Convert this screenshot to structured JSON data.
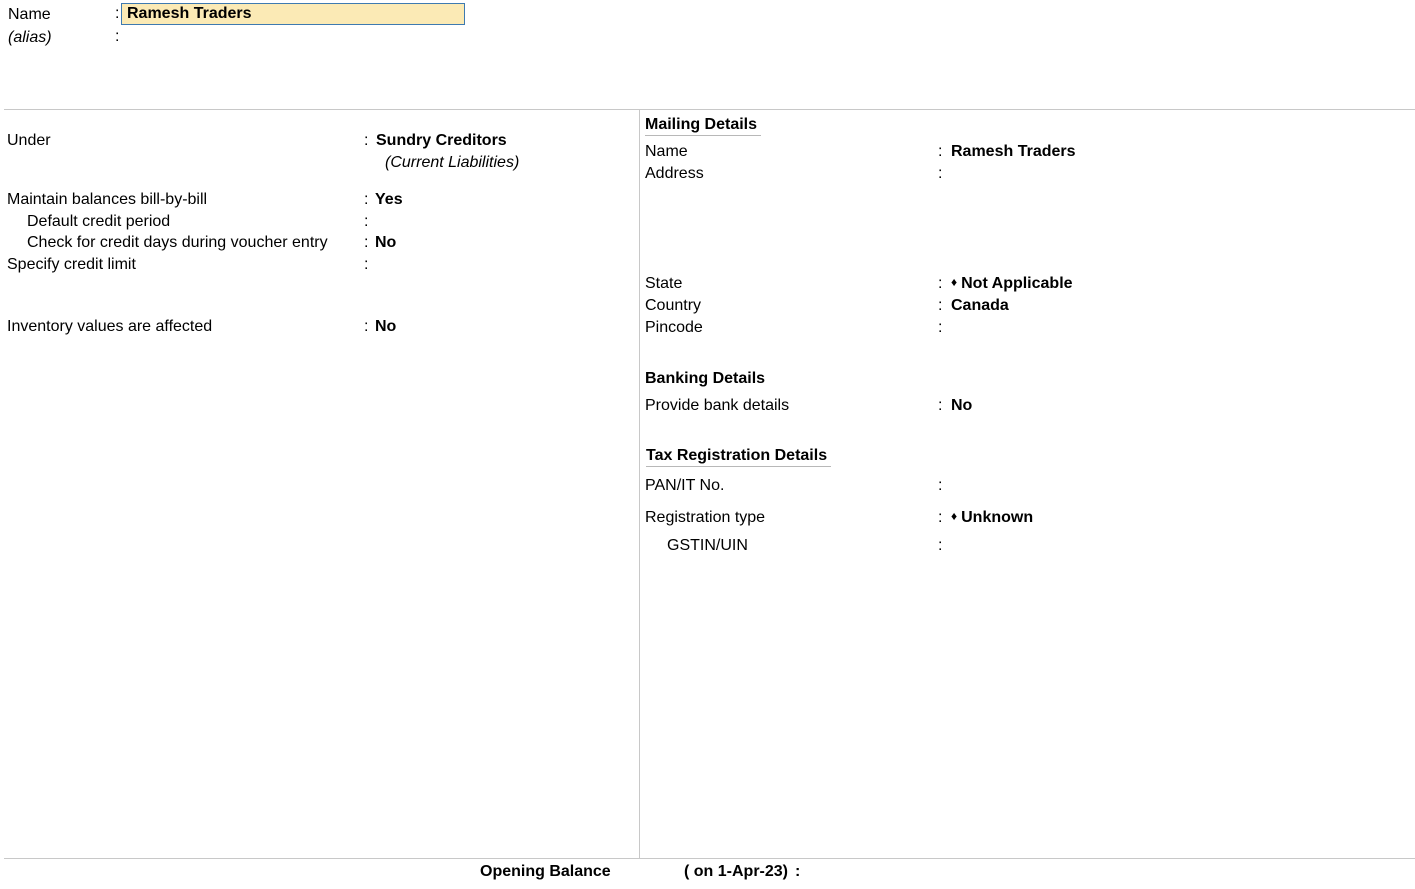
{
  "header": {
    "name_label": "Name",
    "name_value": "Ramesh Traders",
    "alias_label": "(alias)",
    "colon": ":"
  },
  "left": {
    "under": {
      "label": "Under",
      "value": "Sundry Creditors",
      "sub": "(Current Liabilities)"
    },
    "maintain_bill": {
      "label": "Maintain balances bill-by-bill",
      "value": "Yes"
    },
    "default_credit": {
      "label": "Default credit period",
      "value": ""
    },
    "check_credit": {
      "label": "Check for credit days during voucher entry",
      "value": "No"
    },
    "credit_limit": {
      "label": "Specify credit limit",
      "value": ""
    },
    "inventory": {
      "label": "Inventory values are affected",
      "value": "No"
    }
  },
  "mailing": {
    "title": "Mailing Details",
    "name": {
      "label": "Name",
      "value": "Ramesh Traders"
    },
    "address": {
      "label": "Address",
      "value": ""
    },
    "state": {
      "label": "State",
      "value": "Not Applicable"
    },
    "country": {
      "label": "Country",
      "value": "Canada"
    },
    "pincode": {
      "label": "Pincode",
      "value": ""
    }
  },
  "banking": {
    "title": "Banking Details",
    "provide": {
      "label": "Provide bank details",
      "value": "No"
    }
  },
  "tax": {
    "title": "Tax Registration Details",
    "pan": {
      "label": "PAN/IT No.",
      "value": ""
    },
    "reg_type": {
      "label": "Registration type",
      "value": "Unknown"
    },
    "gstin": {
      "label": "GSTIN/UIN",
      "value": ""
    }
  },
  "footer": {
    "opening_label": "Opening Balance",
    "opening_date": "( on 1-Apr-23)",
    "colon": ":"
  },
  "icons": {
    "diamond": "♦"
  },
  "colors": {
    "input_bg": "#fbeab5",
    "input_border": "#3e7ab0",
    "divider": "#c8c8c8"
  }
}
